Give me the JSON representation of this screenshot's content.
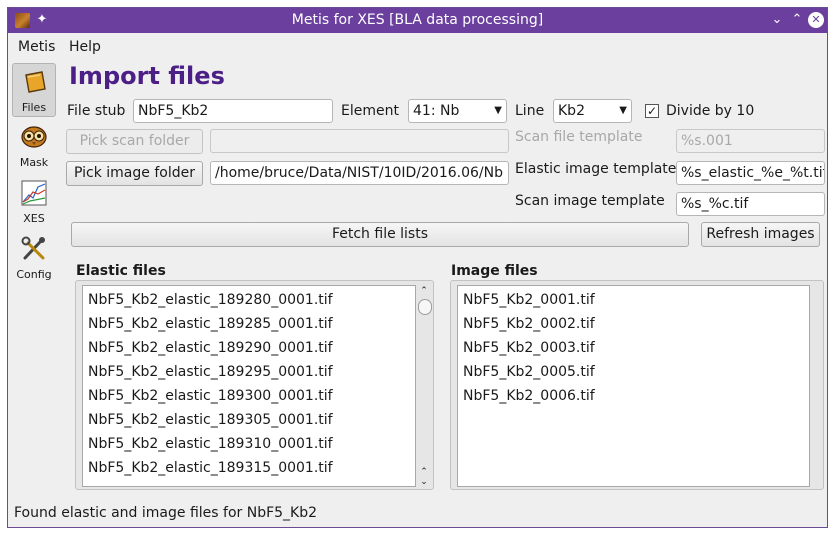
{
  "window": {
    "title": "Metis for XES [BLA data processing]",
    "pin_glyph": "✦",
    "controls": {
      "minimize": "⌄",
      "maximize": "⌃",
      "close": "✕"
    }
  },
  "menu": {
    "items": [
      {
        "label": "Metis"
      },
      {
        "label": "Help"
      }
    ]
  },
  "sidebar": {
    "items": [
      {
        "label": "Files",
        "icon": "folder-icon"
      },
      {
        "label": "Mask",
        "icon": "owl-mask-icon"
      },
      {
        "label": "XES",
        "icon": "xes-plot-icon"
      },
      {
        "label": "Config",
        "icon": "tools-icon"
      }
    ]
  },
  "heading": "Import files",
  "form": {
    "file_stub_label": "File stub",
    "file_stub_value": "NbF5_Kb2",
    "element_label": "Element",
    "element_value": "41: Nb",
    "line_label": "Line",
    "line_value": "Kb2",
    "divide_label": "Divide by 10",
    "divide_checked": "✓",
    "pick_scan_folder": "Pick scan folder",
    "scan_folder_value": "",
    "scan_file_template_label": "Scan file template",
    "scan_file_template_value": "%s.001",
    "pick_image_folder": "Pick image folder",
    "image_folder_value": "/home/bruce/Data/NIST/10ID/2016.06/Nb",
    "elastic_image_template_label": "Elastic image template",
    "elastic_image_template_value": "%s_elastic_%e_%t.tif",
    "scan_image_template_label": "Scan image template",
    "scan_image_template_value": "%s_%c.tif",
    "fetch_button": "Fetch file lists",
    "refresh_button": "Refresh images"
  },
  "elastic_files": {
    "title": "Elastic files",
    "items": [
      "NbF5_Kb2_elastic_189280_0001.tif",
      "NbF5_Kb2_elastic_189285_0001.tif",
      "NbF5_Kb2_elastic_189290_0001.tif",
      "NbF5_Kb2_elastic_189295_0001.tif",
      "NbF5_Kb2_elastic_189300_0001.tif",
      "NbF5_Kb2_elastic_189305_0001.tif",
      "NbF5_Kb2_elastic_189310_0001.tif",
      "NbF5_Kb2_elastic_189315_0001.tif"
    ]
  },
  "image_files": {
    "title": "Image files",
    "items": [
      "NbF5_Kb2_0001.tif",
      "NbF5_Kb2_0002.tif",
      "NbF5_Kb2_0003.tif",
      "NbF5_Kb2_0005.tif",
      "NbF5_Kb2_0006.tif"
    ]
  },
  "status": "Found elastic and image files for NbF5_Kb2",
  "colors": {
    "titlebar": "#6a3f9e",
    "heading": "#4b1f86"
  }
}
